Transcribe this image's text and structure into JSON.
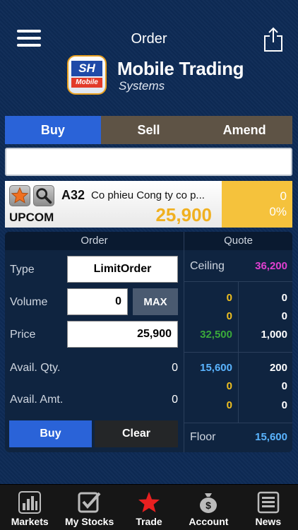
{
  "header": {
    "title": "Order"
  },
  "brand": {
    "logo_mark": "SH",
    "logo_sub": "Mobile",
    "title": "Mobile Trading",
    "subtitle": "Systems"
  },
  "tabs": [
    {
      "label": "Buy"
    },
    {
      "label": "Sell"
    },
    {
      "label": "Amend"
    }
  ],
  "symbol_input": {
    "value": "",
    "placeholder": ""
  },
  "stock": {
    "exchange": "UPCOM",
    "code": "A32",
    "name": "Co phieu Cong ty co p...",
    "price": "25,900",
    "change": "0",
    "change_pct": "0%"
  },
  "order": {
    "header": "Order",
    "type_label": "Type",
    "type_value": "LimitOrder",
    "volume_label": "Volume",
    "volume_value": "0",
    "max_label": "MAX",
    "price_label": "Price",
    "price_value": "25,900",
    "avail_qty_label": "Avail. Qty.",
    "avail_qty_value": "0",
    "avail_amt_label": "Avail. Amt.",
    "avail_amt_value": "0",
    "buy_label": "Buy",
    "clear_label": "Clear"
  },
  "quote": {
    "header": "Quote",
    "ceiling_label": "Ceiling",
    "ceiling_value": "36,200",
    "bids": [
      {
        "price": "0",
        "volume": "0"
      },
      {
        "price": "0",
        "volume": "0"
      },
      {
        "price": "32,500",
        "volume": "1,000"
      }
    ],
    "asks": [
      {
        "price": "15,600",
        "volume": "200"
      },
      {
        "price": "0",
        "volume": "0"
      },
      {
        "price": "0",
        "volume": "0"
      }
    ],
    "floor_label": "Floor",
    "floor_value": "15,600"
  },
  "colors": {
    "ceiling": "#e040d0",
    "bid_zero": "#f0c020",
    "match": "#3aaa3a",
    "ask": "#5ab4ff",
    "floor": "#5ab4ff",
    "accent": "#2a63d8"
  },
  "tabbar": [
    {
      "label": "Markets",
      "icon": "bar-chart-icon"
    },
    {
      "label": "My Stocks",
      "icon": "checkbox-icon"
    },
    {
      "label": "Trade",
      "icon": "star-icon"
    },
    {
      "label": "Account",
      "icon": "money-bag-icon"
    },
    {
      "label": "News",
      "icon": "newspaper-icon"
    }
  ]
}
